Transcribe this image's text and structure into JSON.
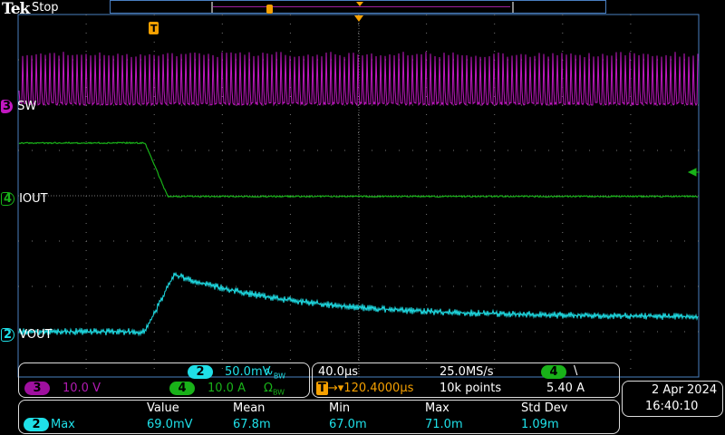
{
  "header": {
    "brand": "Tek",
    "acq_state": "Stop"
  },
  "channels": {
    "ch3": {
      "num": "3",
      "label": "SW",
      "scale": "10.0 V",
      "color": "#c218c2"
    },
    "ch4": {
      "num": "4",
      "label": "IOUT",
      "scale": "10.0 A",
      "bw": "Ω",
      "bw_sub": "BW",
      "color": "#19b219"
    },
    "ch2": {
      "num": "2",
      "label": "VOUT",
      "scale": "50.0mV",
      "bw": "∿",
      "bw_sub": "BW",
      "color": "#1fe0e8"
    }
  },
  "horizontal": {
    "time_div": "40.0µs",
    "sample_rate": "25.0MS/s",
    "delay": "120.4000µs",
    "record": "10k points",
    "trigger_marker": "T"
  },
  "trigger": {
    "source": "4",
    "slope": "\\",
    "level": "5.40 A"
  },
  "datetime": {
    "date": "2 Apr  2024",
    "time": "16:40:10"
  },
  "measurements": {
    "headers": [
      "Value",
      "Mean",
      "Min",
      "Max",
      "Std Dev"
    ],
    "rows": [
      {
        "source": "2",
        "name": "Max",
        "values": [
          "69.0mV",
          "67.8m",
          "67.0m",
          "71.0m",
          "1.09m"
        ]
      }
    ]
  }
}
